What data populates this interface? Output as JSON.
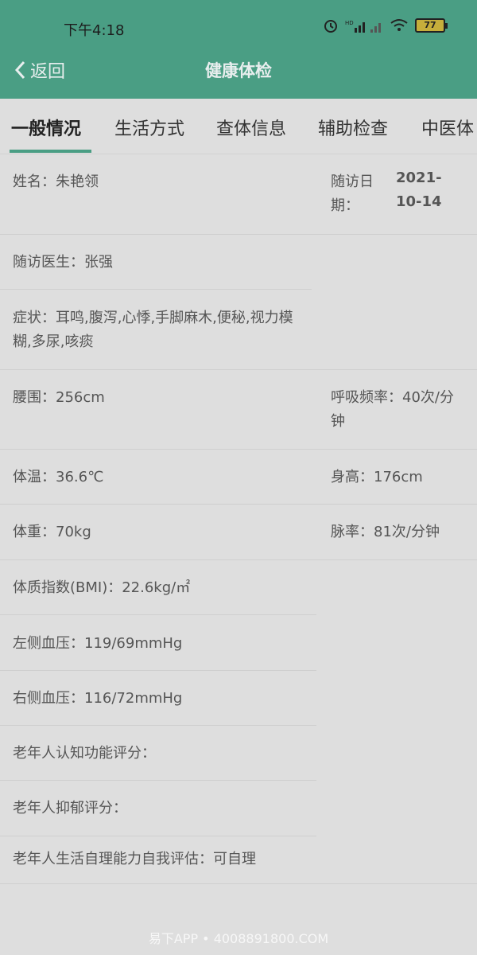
{
  "status": {
    "time": "下午4:18",
    "battery": "77"
  },
  "header": {
    "back_label": "返回",
    "title": "健康体检"
  },
  "tabs": [
    "一般情况",
    "生活方式",
    "查体信息",
    "辅助检查",
    "中医体"
  ],
  "fields": {
    "name": "姓名：朱艳领",
    "visit_date_label": "随访日期：",
    "visit_date_value": "2021-10-14",
    "doctor": "随访医生：张强",
    "symptoms": "症状：耳鸣,腹泻,心悸,手脚麻木,便秘,视力模糊,多尿,咳痰",
    "waist": "腰围：256cm",
    "breath": "呼吸频率：40次/分钟",
    "temp": "体温：36.6℃",
    "height": "身高：176cm",
    "weight": "体重：70kg",
    "pulse": "脉率：81次/分钟",
    "bmi": "体质指数(BMI)：22.6kg/㎡",
    "bp_left": "左侧血压：119/69mmHg",
    "bp_right": "右侧血压：116/72mmHg",
    "cognitive": "老年人认知功能评分：",
    "depression": "老年人抑郁评分：",
    "self_care": "老年人生活自理能力自我评估：可自理"
  },
  "watermark": "易下APP • 4008891800.COM"
}
